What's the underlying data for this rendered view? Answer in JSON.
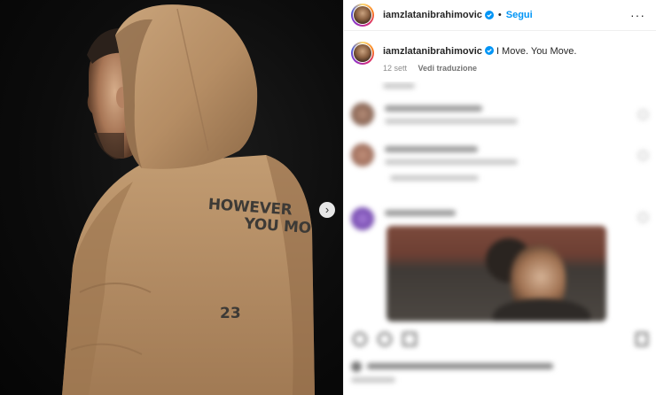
{
  "post": {
    "photo": {
      "hoodie_text_line1": "HOWEVER",
      "hoodie_text_line2": "YOU MO",
      "hoodie_number": "23",
      "next_icon": "chevron-right-icon"
    },
    "header": {
      "username": "iamzlatanibrahimovic",
      "separator": "•",
      "follow_label": "Segui",
      "more_icon": "more-horizontal-icon",
      "more_label": "···"
    },
    "caption": {
      "username": "iamzlatanibrahimovic",
      "text": "I Move. You Move.",
      "date": "12 sett",
      "translate_label": "Vedi traduzione"
    },
    "colors": {
      "follow_blue": "#0095f6",
      "verified_blue": "#0095f6",
      "hoodie_beige": "#b8926a"
    }
  }
}
